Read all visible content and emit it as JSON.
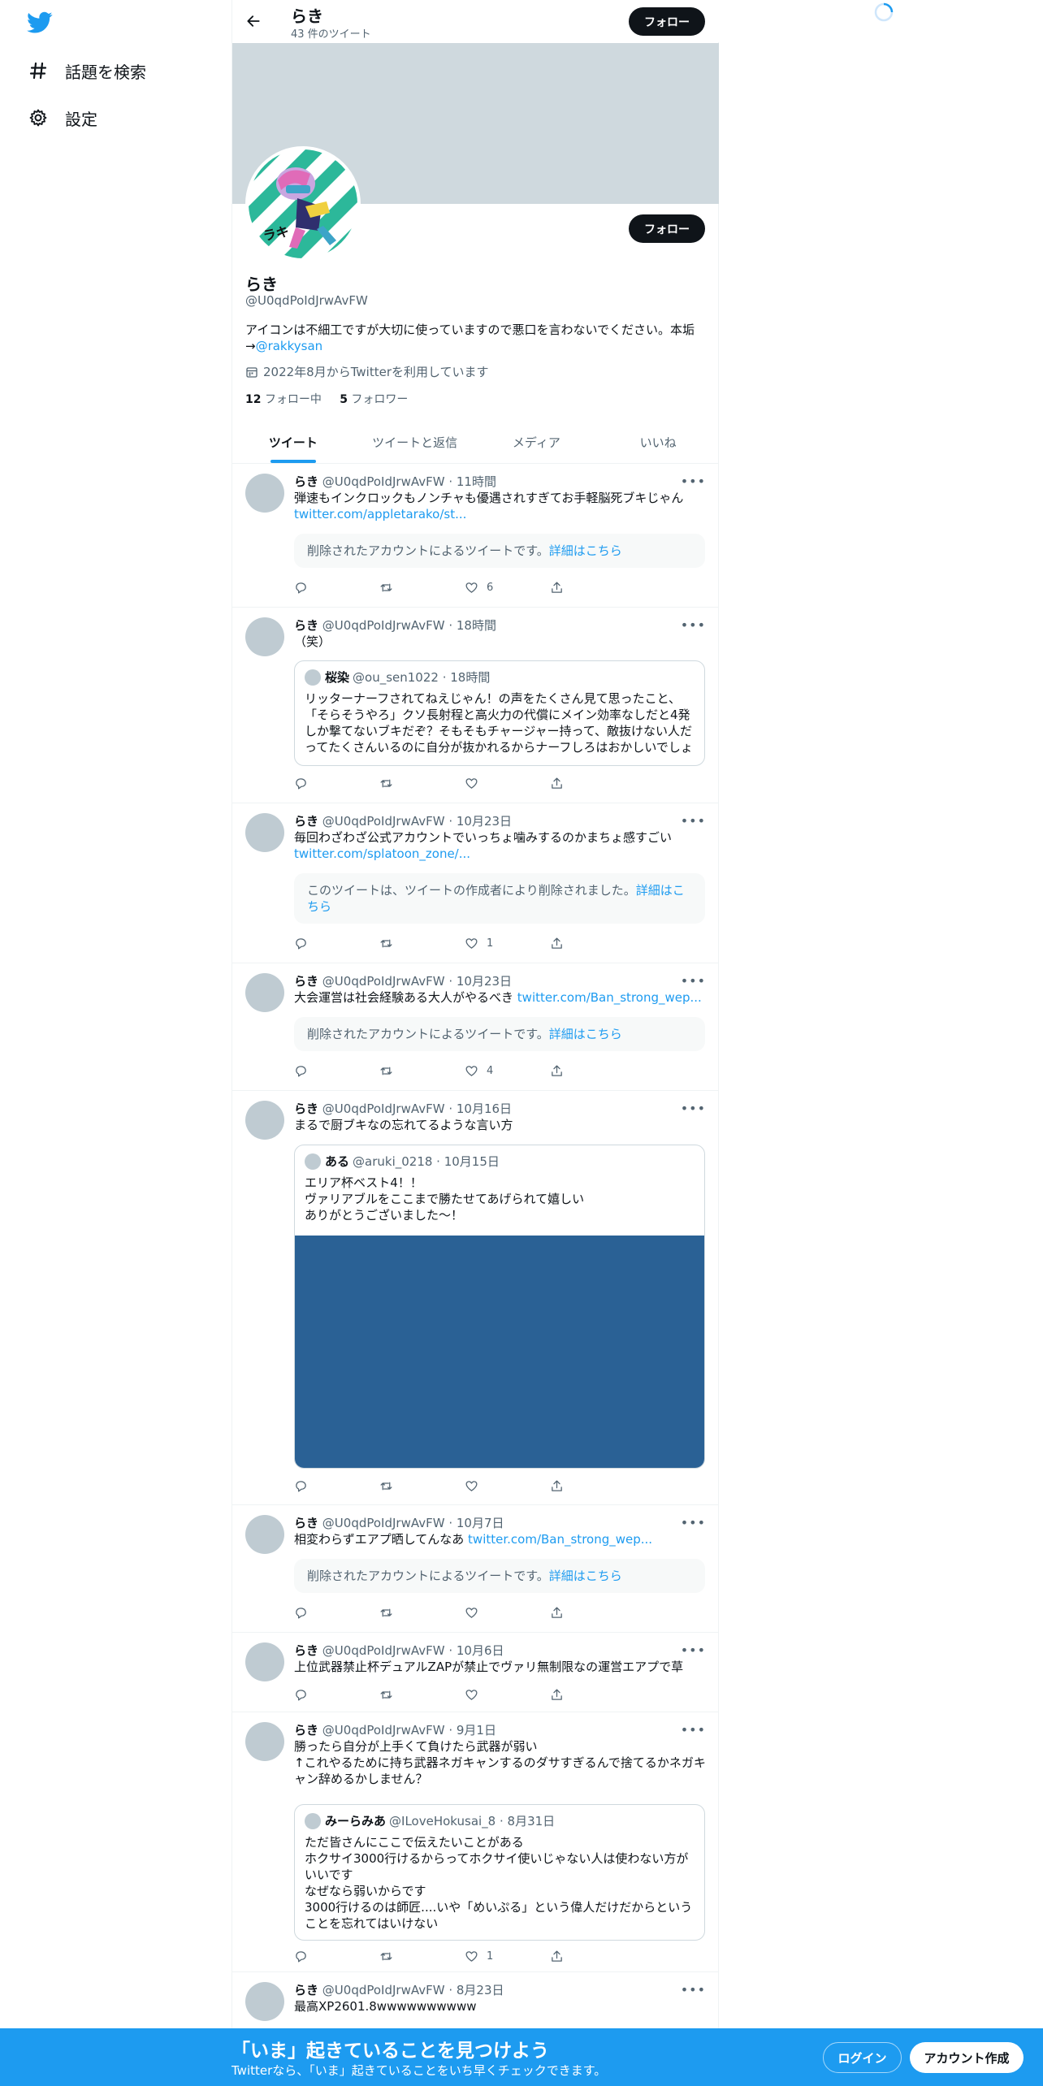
{
  "nav": {
    "items": [
      {
        "label": "話題を検索",
        "icon": "hashtag-icon"
      },
      {
        "label": "設定",
        "icon": "gear-icon"
      }
    ]
  },
  "header": {
    "name": "らき",
    "tweet_count": "43 件のツイート",
    "follow_label": "フォロー"
  },
  "profile": {
    "name": "らき",
    "handle": "@U0qdPoIdJrwAvFW",
    "bio_line1": "アイコンは不細工ですが大切に使っていますので悪口を言わないでください。本垢",
    "bio_arrow": "→",
    "bio_link": "@rakkysan",
    "joined": "2022年8月からTwitterを利用しています",
    "following_count": "12",
    "following_label": "フォロー中",
    "followers_count": "5",
    "followers_label": "フォロワー",
    "follow_label": "フォロー"
  },
  "tabs": [
    "ツイート",
    "ツイートと返信",
    "メディア",
    "いいね"
  ],
  "tweets": [
    {
      "name": "らき",
      "meta": "@U0qdPoIdJrwAvFW · 11時間",
      "text": "弾速もインクロックもノンチャも優遇されすぎてお手軽脳死ブキじゃん",
      "link": "twitter.com/appletarako/st...",
      "deleted_text": "削除されたアカウントによるツイートです。",
      "deleted_link": "詳細はこちら",
      "likes": "6"
    },
    {
      "name": "らき",
      "meta": "@U0qdPoIdJrwAvFW · 18時間",
      "text": "（笑）",
      "quote_name": "桜染",
      "quote_meta": "@ou_sen1022 · 18時間",
      "quote_text": "リッターナーフされてねえじゃん！の声をたくさん見て思ったこと、「そらそうやろ」クソ長射程と高火力の代償にメイン効率なしだと4発しか撃てないブキだぞ？そもそもチャージャー持って、敵抜けない人だってたくさんいるのに自分が抜かれるからナーフしろはおかしいでしょ"
    },
    {
      "name": "らき",
      "meta": "@U0qdPoIdJrwAvFW · 10月23日",
      "text": "毎回わざわざ公式アカウントでいっちょ噛みするのかまちょ感すごい",
      "link": "twitter.com/splatoon_zone/...",
      "deleted_text": "このツイートは、ツイートの作成者により削除されました。",
      "deleted_link": "詳細はこちら",
      "likes": "1"
    },
    {
      "name": "らき",
      "meta": "@U0qdPoIdJrwAvFW · 10月23日",
      "text": "大会運営は社会経験ある大人がやるべき",
      "link": "twitter.com/Ban_strong_wep...",
      "deleted_text": "削除されたアカウントによるツイートです。",
      "deleted_link": "詳細はこちら",
      "likes": "4"
    },
    {
      "name": "らき",
      "meta": "@U0qdPoIdJrwAvFW · 10月16日",
      "text": "まるで厨ブキなの忘れてるような言い方",
      "quote_name": "ある",
      "quote_meta": "@aruki_0218 · 10月15日",
      "quote_text": "エリア杯ベスト4！！\nヴァリアブルをここまで勝たせてあげられて嬉しい\nありがとうございました～！"
    },
    {
      "name": "らき",
      "meta": "@U0qdPoIdJrwAvFW · 10月7日",
      "text": "相変わらずエアプ晒してんなあ",
      "link": "twitter.com/Ban_strong_wep...",
      "deleted_text": "削除されたアカウントによるツイートです。",
      "deleted_link": "詳細はこちら"
    },
    {
      "name": "らき",
      "meta": "@U0qdPoIdJrwAvFW · 10月6日",
      "text": "上位武器禁止杯デュアルZAPが禁止でヴァリ無制限なの運営エアプで草"
    },
    {
      "name": "らき",
      "meta": "@U0qdPoIdJrwAvFW · 9月1日",
      "text": "勝ったら自分が上手くて負けたら武器が弱い\n↑これやるために持ち武器ネガキャンするのダサすぎるんで捨てるかネガキャン辞めるかしません？",
      "quote_name": "みーらみあ",
      "quote_meta": "@ILoveHokusai_8 · 8月31日",
      "quote_text": "ただ皆さんにここで伝えたいことがある\nホクサイ3000行けるからってホクサイ使いじゃない人は使わない方がいいです\nなぜなら弱いからです\n3000行けるのは師匠....いや「めいぷる」という偉人だけだからということを忘れてはいけない",
      "likes": "1"
    },
    {
      "name": "らき",
      "meta": "@U0qdPoIdJrwAvFW · 8月23日",
      "text": "最高XP2601.8wwwwwwwwww"
    }
  ],
  "bottom": {
    "title": "「いま」起きていることを見つけよう",
    "subtitle": "Twitterなら、「いま」起きていることをいち早くチェックできます。",
    "login": "ログイン",
    "signup": "アカウント作成"
  },
  "colors": {
    "accent": "#1d9bf0",
    "banner": "#cfd9de",
    "text": "#0f1419",
    "muted": "#536471",
    "media": "#2a6195"
  }
}
